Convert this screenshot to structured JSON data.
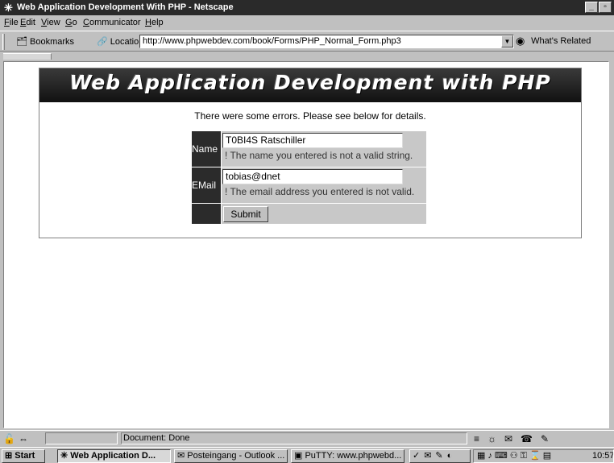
{
  "window": {
    "title": "Web Application Development With PHP - Netscape",
    "minimize_label": "_",
    "restore_label": "▫",
    "close_label": "×"
  },
  "menu": [
    "File",
    "Edit",
    "View",
    "Go",
    "Communicator",
    "Help"
  ],
  "menu_mnemonics": [
    "F",
    "E",
    "V",
    "G",
    "C",
    "H"
  ],
  "toolbar": {
    "bookmarks_label": "Bookmarks",
    "location_label": "Location:",
    "url": "http://www.phpwebdev.com/book/Forms/PHP_Normal_Form.php3",
    "related_label": "What's Related"
  },
  "page": {
    "banner_title": "Web Application Development with PHP",
    "error_message": "There were some errors. Please see below for details.",
    "form": {
      "name_label": "Name",
      "name_value": "T0BI4S Ratschiller",
      "name_error": "! The name you entered is not a valid string.",
      "email_label": "EMail",
      "email_value": "tobias@dnet",
      "email_error": "! The email address you entered is not valid.",
      "submit_label": "Submit"
    }
  },
  "status": {
    "text": "Document: Done"
  },
  "taskbar": {
    "start_label": "Start",
    "tasks": [
      {
        "label": "Web Application D...",
        "active": true
      },
      {
        "label": "Posteingang - Outlook ...",
        "active": false
      },
      {
        "label": "PuTTY: www.phpwebd...",
        "active": false
      }
    ],
    "clock": "10:57"
  },
  "colors": {
    "banner_bg": "#1c1c1c",
    "label_bg": "#2b2b2b",
    "cell_bg": "#c8c8c8",
    "chrome_bg": "#c0c0c0"
  },
  "icons": {
    "app": "netscape-icon",
    "bookmarks": "bookmark-icon",
    "location": "location-icon",
    "related": "related-icon"
  }
}
